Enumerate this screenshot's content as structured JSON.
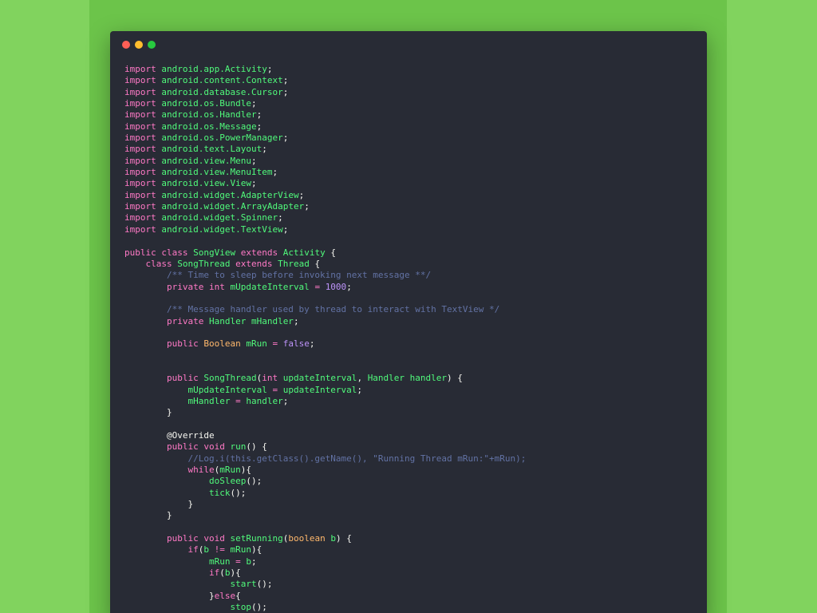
{
  "window": {
    "buttons": [
      {
        "name": "close",
        "color": "#ff5f56"
      },
      {
        "name": "minimize",
        "color": "#ffbd2e"
      },
      {
        "name": "zoom",
        "color": "#27c93f"
      }
    ]
  },
  "theme": {
    "keyword": "#ff79c6",
    "name": "#50fa7b",
    "type": "#ffb86c",
    "comment": "#6272a4",
    "string": "#f1fa8c",
    "number": "#bd93f9",
    "plain": "#f8f8f2",
    "background": "#282b35"
  },
  "code": {
    "lines": [
      [
        [
          "kw",
          "import"
        ],
        [
          "pl",
          " "
        ],
        [
          "nm",
          "android.app.Activity"
        ],
        [
          "pl",
          ";"
        ]
      ],
      [
        [
          "kw",
          "import"
        ],
        [
          "pl",
          " "
        ],
        [
          "nm",
          "android.content.Context"
        ],
        [
          "pl",
          ";"
        ]
      ],
      [
        [
          "kw",
          "import"
        ],
        [
          "pl",
          " "
        ],
        [
          "nm",
          "android.database.Cursor"
        ],
        [
          "pl",
          ";"
        ]
      ],
      [
        [
          "kw",
          "import"
        ],
        [
          "pl",
          " "
        ],
        [
          "nm",
          "android.os.Bundle"
        ],
        [
          "pl",
          ";"
        ]
      ],
      [
        [
          "kw",
          "import"
        ],
        [
          "pl",
          " "
        ],
        [
          "nm",
          "android.os.Handler"
        ],
        [
          "pl",
          ";"
        ]
      ],
      [
        [
          "kw",
          "import"
        ],
        [
          "pl",
          " "
        ],
        [
          "nm",
          "android.os.Message"
        ],
        [
          "pl",
          ";"
        ]
      ],
      [
        [
          "kw",
          "import"
        ],
        [
          "pl",
          " "
        ],
        [
          "nm",
          "android.os.PowerManager"
        ],
        [
          "pl",
          ";"
        ]
      ],
      [
        [
          "kw",
          "import"
        ],
        [
          "pl",
          " "
        ],
        [
          "nm",
          "android.text.Layout"
        ],
        [
          "pl",
          ";"
        ]
      ],
      [
        [
          "kw",
          "import"
        ],
        [
          "pl",
          " "
        ],
        [
          "nm",
          "android.view.Menu"
        ],
        [
          "pl",
          ";"
        ]
      ],
      [
        [
          "kw",
          "import"
        ],
        [
          "pl",
          " "
        ],
        [
          "nm",
          "android.view.MenuItem"
        ],
        [
          "pl",
          ";"
        ]
      ],
      [
        [
          "kw",
          "import"
        ],
        [
          "pl",
          " "
        ],
        [
          "nm",
          "android.view.View"
        ],
        [
          "pl",
          ";"
        ]
      ],
      [
        [
          "kw",
          "import"
        ],
        [
          "pl",
          " "
        ],
        [
          "nm",
          "android.widget.AdapterView"
        ],
        [
          "pl",
          ";"
        ]
      ],
      [
        [
          "kw",
          "import"
        ],
        [
          "pl",
          " "
        ],
        [
          "nm",
          "android.widget.ArrayAdapter"
        ],
        [
          "pl",
          ";"
        ]
      ],
      [
        [
          "kw",
          "import"
        ],
        [
          "pl",
          " "
        ],
        [
          "nm",
          "android.widget.Spinner"
        ],
        [
          "pl",
          ";"
        ]
      ],
      [
        [
          "kw",
          "import"
        ],
        [
          "pl",
          " "
        ],
        [
          "nm",
          "android.widget.TextView"
        ],
        [
          "pl",
          ";"
        ]
      ],
      [],
      [
        [
          "kw",
          "public"
        ],
        [
          "pl",
          " "
        ],
        [
          "kw",
          "class"
        ],
        [
          "pl",
          " "
        ],
        [
          "nm",
          "SongView"
        ],
        [
          "pl",
          " "
        ],
        [
          "kw",
          "extends"
        ],
        [
          "pl",
          " "
        ],
        [
          "nm",
          "Activity"
        ],
        [
          "pl",
          " {"
        ]
      ],
      [
        [
          "pl",
          "    "
        ],
        [
          "kw",
          "class"
        ],
        [
          "pl",
          " "
        ],
        [
          "nm",
          "SongThread"
        ],
        [
          "pl",
          " "
        ],
        [
          "kw",
          "extends"
        ],
        [
          "pl",
          " "
        ],
        [
          "nm",
          "Thread"
        ],
        [
          "pl",
          " {"
        ]
      ],
      [
        [
          "pl",
          "        "
        ],
        [
          "cm",
          "/** Time to sleep before invoking next message **/"
        ]
      ],
      [
        [
          "pl",
          "        "
        ],
        [
          "kw",
          "private"
        ],
        [
          "pl",
          " "
        ],
        [
          "kw",
          "int"
        ],
        [
          "pl",
          " "
        ],
        [
          "nm",
          "mUpdateInterval"
        ],
        [
          "pl",
          " "
        ],
        [
          "kw",
          "="
        ],
        [
          "pl",
          " "
        ],
        [
          "nu",
          "1000"
        ],
        [
          "pl",
          ";"
        ]
      ],
      [],
      [
        [
          "pl",
          "        "
        ],
        [
          "cm",
          "/** Message handler used by thread to interact with TextView */"
        ]
      ],
      [
        [
          "pl",
          "        "
        ],
        [
          "kw",
          "private"
        ],
        [
          "pl",
          " "
        ],
        [
          "nm",
          "Handler"
        ],
        [
          "pl",
          " "
        ],
        [
          "nm",
          "mHandler"
        ],
        [
          "pl",
          ";"
        ]
      ],
      [],
      [
        [
          "pl",
          "        "
        ],
        [
          "kw",
          "public"
        ],
        [
          "pl",
          " "
        ],
        [
          "ty",
          "Boolean"
        ],
        [
          "pl",
          " "
        ],
        [
          "nm",
          "mRun"
        ],
        [
          "pl",
          " "
        ],
        [
          "kw",
          "="
        ],
        [
          "pl",
          " "
        ],
        [
          "nu",
          "false"
        ],
        [
          "pl",
          ";"
        ]
      ],
      [],
      [],
      [
        [
          "pl",
          "        "
        ],
        [
          "kw",
          "public"
        ],
        [
          "pl",
          " "
        ],
        [
          "nm",
          "SongThread"
        ],
        [
          "pl",
          "("
        ],
        [
          "kw",
          "int"
        ],
        [
          "pl",
          " "
        ],
        [
          "nm",
          "updateInterval"
        ],
        [
          "pl",
          ", "
        ],
        [
          "nm",
          "Handler"
        ],
        [
          "pl",
          " "
        ],
        [
          "nm",
          "handler"
        ],
        [
          "pl",
          ") {"
        ]
      ],
      [
        [
          "pl",
          "            "
        ],
        [
          "nm",
          "mUpdateInterval"
        ],
        [
          "pl",
          " "
        ],
        [
          "kw",
          "="
        ],
        [
          "pl",
          " "
        ],
        [
          "nm",
          "updateInterval"
        ],
        [
          "pl",
          ";"
        ]
      ],
      [
        [
          "pl",
          "            "
        ],
        [
          "nm",
          "mHandler"
        ],
        [
          "pl",
          " "
        ],
        [
          "kw",
          "="
        ],
        [
          "pl",
          " "
        ],
        [
          "nm",
          "handler"
        ],
        [
          "pl",
          ";"
        ]
      ],
      [
        [
          "pl",
          "        }"
        ]
      ],
      [],
      [
        [
          "pl",
          "        @Override"
        ]
      ],
      [
        [
          "pl",
          "        "
        ],
        [
          "kw",
          "public"
        ],
        [
          "pl",
          " "
        ],
        [
          "kw",
          "void"
        ],
        [
          "pl",
          " "
        ],
        [
          "nm",
          "run"
        ],
        [
          "pl",
          "() {"
        ]
      ],
      [
        [
          "pl",
          "            "
        ],
        [
          "cm",
          "//Log.i(this.getClass().getName(), \"Running Thread mRun:\"+mRun);"
        ]
      ],
      [
        [
          "pl",
          "            "
        ],
        [
          "kw",
          "while"
        ],
        [
          "pl",
          "("
        ],
        [
          "nm",
          "mRun"
        ],
        [
          "pl",
          "){"
        ]
      ],
      [
        [
          "pl",
          "                "
        ],
        [
          "nm",
          "doSleep"
        ],
        [
          "pl",
          "();"
        ]
      ],
      [
        [
          "pl",
          "                "
        ],
        [
          "nm",
          "tick"
        ],
        [
          "pl",
          "();"
        ]
      ],
      [
        [
          "pl",
          "            }"
        ]
      ],
      [
        [
          "pl",
          "        }"
        ]
      ],
      [],
      [
        [
          "pl",
          "        "
        ],
        [
          "kw",
          "public"
        ],
        [
          "pl",
          " "
        ],
        [
          "kw",
          "void"
        ],
        [
          "pl",
          " "
        ],
        [
          "nm",
          "setRunning"
        ],
        [
          "pl",
          "("
        ],
        [
          "ty",
          "boolean"
        ],
        [
          "pl",
          " "
        ],
        [
          "nm",
          "b"
        ],
        [
          "pl",
          ") {"
        ]
      ],
      [
        [
          "pl",
          "            "
        ],
        [
          "kw",
          "if"
        ],
        [
          "pl",
          "("
        ],
        [
          "nm",
          "b"
        ],
        [
          "pl",
          " "
        ],
        [
          "kw",
          "!="
        ],
        [
          "pl",
          " "
        ],
        [
          "nm",
          "mRun"
        ],
        [
          "pl",
          "){"
        ]
      ],
      [
        [
          "pl",
          "                "
        ],
        [
          "nm",
          "mRun"
        ],
        [
          "pl",
          " "
        ],
        [
          "kw",
          "="
        ],
        [
          "pl",
          " "
        ],
        [
          "nm",
          "b"
        ],
        [
          "pl",
          ";"
        ]
      ],
      [
        [
          "pl",
          "                "
        ],
        [
          "kw",
          "if"
        ],
        [
          "pl",
          "("
        ],
        [
          "nm",
          "b"
        ],
        [
          "pl",
          "){"
        ]
      ],
      [
        [
          "pl",
          "                    "
        ],
        [
          "nm",
          "start"
        ],
        [
          "pl",
          "();"
        ]
      ],
      [
        [
          "pl",
          "                }"
        ],
        [
          "kw",
          "else"
        ],
        [
          "pl",
          "{"
        ]
      ],
      [
        [
          "pl",
          "                    "
        ],
        [
          "nm",
          "stop"
        ],
        [
          "pl",
          "();"
        ]
      ]
    ]
  }
}
